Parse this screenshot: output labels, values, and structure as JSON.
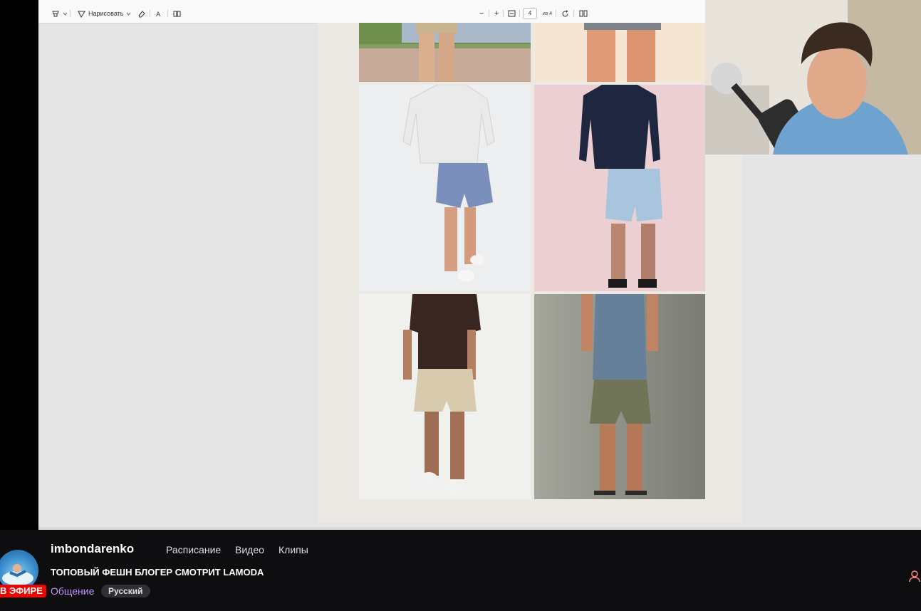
{
  "toolbar": {
    "draw_label": "Нарисовать",
    "page_current": "4",
    "page_total": "из 4",
    "minus_symbol": "−",
    "plus_symbol": "+"
  },
  "stream": {
    "channel_name": "imbondarenko",
    "nav": [
      "Расписание",
      "Видео",
      "Клипы"
    ],
    "title": "ТОПОВЫЙ ФЕШН БЛОГЕР СМОТРИТ LAMODA",
    "category": "Общение",
    "tag": "Русский",
    "live_badge": "В ЭФИРЕ"
  },
  "colors": {
    "twitch_bg": "#0e0e10",
    "live_red": "#eb0400",
    "category_purple": "#bf94ff",
    "viewer_bg": "#e5e5e5"
  },
  "icons": [
    "highlight-icon",
    "draw-icon",
    "eraser-icon",
    "text-icon",
    "fit-page-icon",
    "rotate-icon",
    "two-page-icon",
    "user-icon"
  ]
}
